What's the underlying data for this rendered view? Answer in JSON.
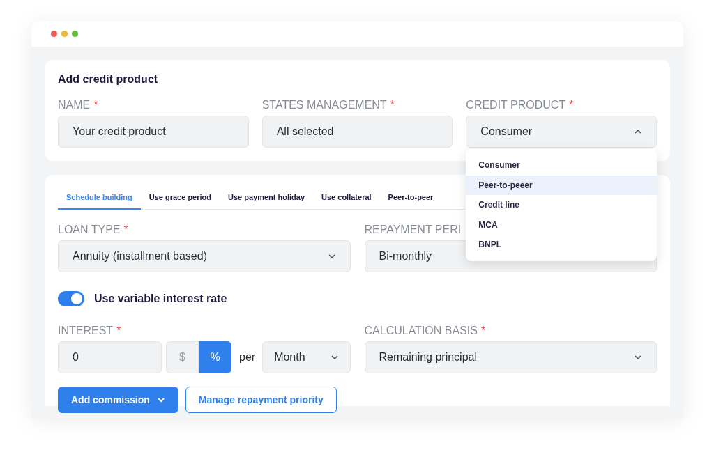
{
  "card_title": "Add credit product",
  "top_fields": [
    {
      "label": "NAME",
      "marker": "*",
      "kind": "input",
      "value": "Your credit product"
    },
    {
      "label": "STATES MANAGEMENT",
      "marker": "*",
      "kind": "input",
      "value": "All selected"
    },
    {
      "label": "CREDIT PRODUCT",
      "marker": "*",
      "kind": "select",
      "value": "Consumer",
      "expanded": true,
      "options": [
        {
          "label": "Consumer",
          "highlighted": false
        },
        {
          "label": "Peer-to-peeer",
          "highlighted": true
        },
        {
          "label": "Credit line",
          "highlighted": false
        },
        {
          "label": "MCA",
          "highlighted": false
        },
        {
          "label": "BNPL",
          "highlighted": false
        }
      ]
    }
  ],
  "tabs": [
    {
      "label": "Schedule building",
      "selected": true
    },
    {
      "label": "Use grace period",
      "selected": false
    },
    {
      "label": "Use payment holiday",
      "selected": false
    },
    {
      "label": "Use collateral",
      "selected": false
    },
    {
      "label": "Peer-to-peer",
      "selected": false
    }
  ],
  "loan_type": {
    "label": "LOAN TYPE",
    "marker": "*",
    "value": "Annuity (installment based)"
  },
  "repayment_period": {
    "label": "REPAYMENT PERI",
    "value": "Bi-monthly"
  },
  "toggle": {
    "label": "Use variable interest rate",
    "on": true
  },
  "interest": {
    "label": "INTEREST",
    "marker": "*",
    "value": "0",
    "units": [
      {
        "label": "$",
        "selected": false
      },
      {
        "label": "%",
        "selected": true
      }
    ],
    "per": "per",
    "period": "Month"
  },
  "calculation_basis": {
    "label": "CALCULATION BASIS",
    "marker": "*",
    "value": "Remaining principal"
  },
  "buttons": [
    {
      "label": "Add commission",
      "kind": "primary"
    },
    {
      "label": "Manage repayment priority",
      "kind": "outline"
    }
  ]
}
